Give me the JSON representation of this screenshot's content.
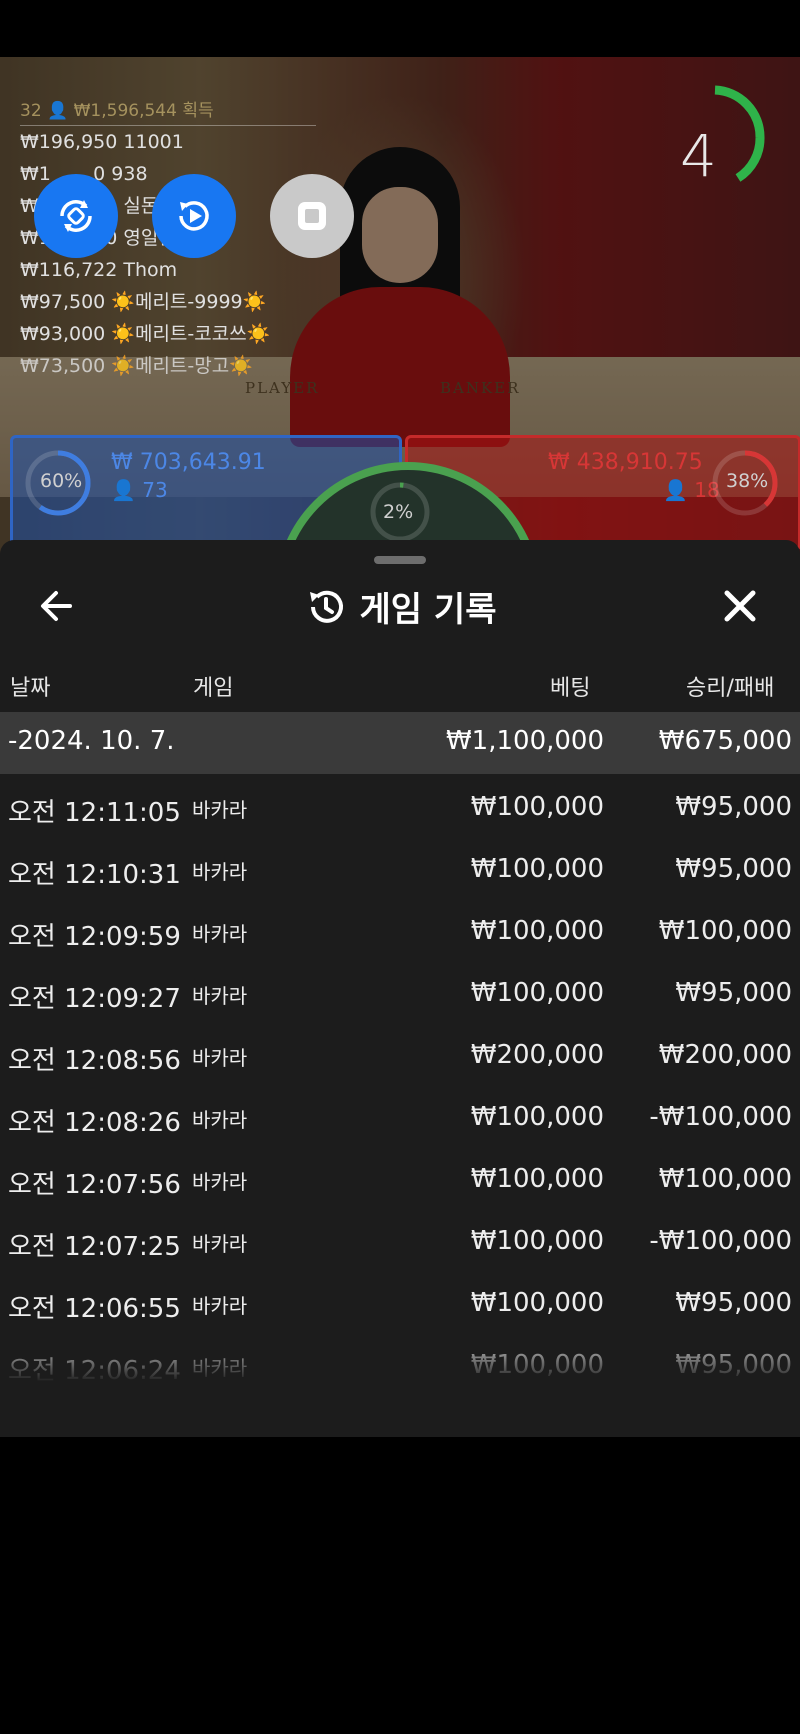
{
  "live": {
    "winners_header": "32 👤 ₩1,596,544 획득",
    "winners": [
      "₩196,950 11001",
      "₩1       0 938",
      "₩              실돈",
      "₩124,000 영일만 친구",
      "₩116,722 Thom",
      "₩97,500 ☀️메리트-9999☀️",
      "₩93,000 ☀️메리트-코코쓰☀️",
      "₩73,500 ☀️메리트-망고☀️"
    ],
    "countdown": "4",
    "felt_player": "PLAYER",
    "felt_banker": "BANKER",
    "player": {
      "percent": "60%",
      "amount": "₩ 703,643.91",
      "count": "73"
    },
    "banker": {
      "percent": "38%",
      "amount": "₩ 438,910.75",
      "count": "18"
    },
    "tie": {
      "percent": "2%"
    },
    "colors": {
      "player": "#2f65c4",
      "banker": "#c42a2a",
      "tie": "#4aa14f",
      "accent": "#1877f2"
    },
    "buttons": [
      "autoplay-icon",
      "replay-icon",
      "stop-icon"
    ]
  },
  "sheet": {
    "title": "게임 기록",
    "back_icon": "arrow-left-icon",
    "history_icon": "history-icon",
    "close_icon": "close-icon",
    "columns": {
      "date": "날짜",
      "game": "게임",
      "bet": "베팅",
      "result": "승리/패배"
    },
    "summary": {
      "date": "-2024. 10. 7.",
      "bet": "₩1,100,000",
      "result": "₩675,000"
    },
    "rows": [
      {
        "time": "오전 12:11:05",
        "game": "바카라",
        "bet": "₩100,000",
        "result": "₩95,000"
      },
      {
        "time": "오전 12:10:31",
        "game": "바카라",
        "bet": "₩100,000",
        "result": "₩95,000"
      },
      {
        "time": "오전 12:09:59",
        "game": "바카라",
        "bet": "₩100,000",
        "result": "₩100,000"
      },
      {
        "time": "오전 12:09:27",
        "game": "바카라",
        "bet": "₩100,000",
        "result": "₩95,000"
      },
      {
        "time": "오전 12:08:56",
        "game": "바카라",
        "bet": "₩200,000",
        "result": "₩200,000"
      },
      {
        "time": "오전 12:08:26",
        "game": "바카라",
        "bet": "₩100,000",
        "result": "-₩100,000"
      },
      {
        "time": "오전 12:07:56",
        "game": "바카라",
        "bet": "₩100,000",
        "result": "₩100,000"
      },
      {
        "time": "오전 12:07:25",
        "game": "바카라",
        "bet": "₩100,000",
        "result": "-₩100,000"
      },
      {
        "time": "오전 12:06:55",
        "game": "바카라",
        "bet": "₩100,000",
        "result": "₩95,000"
      },
      {
        "time": "오전 12:06:24",
        "game": "바카라",
        "bet": "₩100,000",
        "result": "₩95,000"
      }
    ]
  }
}
